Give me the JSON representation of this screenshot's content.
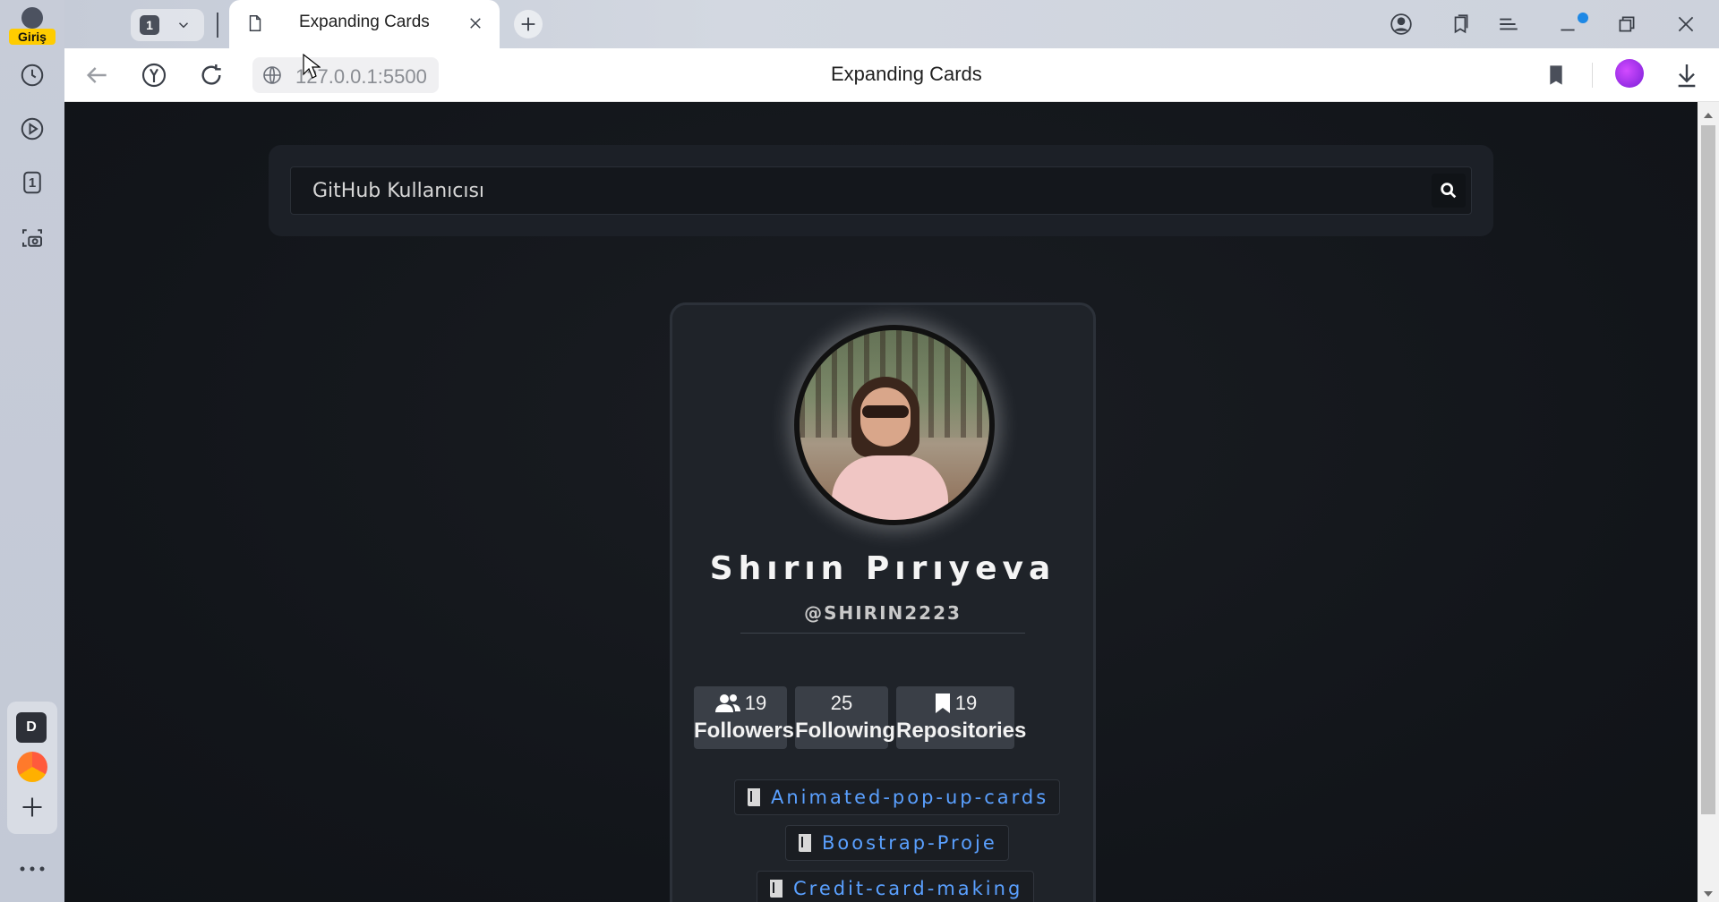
{
  "browser": {
    "profile_label": "Giriş",
    "tab_count": "1",
    "tab_title": "Expanding Cards",
    "url": "127.0.0.1:5500",
    "page_title": "Expanding Cards",
    "sidebar_badge": "D",
    "sidebar_counter": "1"
  },
  "page": {
    "search": {
      "placeholder": "GitHub Kullanıcısı",
      "value": ""
    },
    "profile": {
      "name": "Shırın Pırıyeva",
      "handle": "@SHIRIN2223",
      "stats": [
        {
          "value": "19",
          "label": "Followers",
          "icon": "users-icon"
        },
        {
          "value": "25",
          "label": "Following",
          "icon": ""
        },
        {
          "value": "19",
          "label": "Repositories",
          "icon": "bookmark-icon"
        }
      ],
      "repos": [
        "Animated-pop-up-cards",
        "Boostrap-Proje",
        "Credit-card-making"
      ]
    }
  },
  "colors": {
    "page_bg": "#12151a",
    "card_bg": "#1f2329",
    "repo_link": "#5aa0ff",
    "stat_bg": "#3a3f47",
    "profile_badge": "#ffcc00"
  }
}
